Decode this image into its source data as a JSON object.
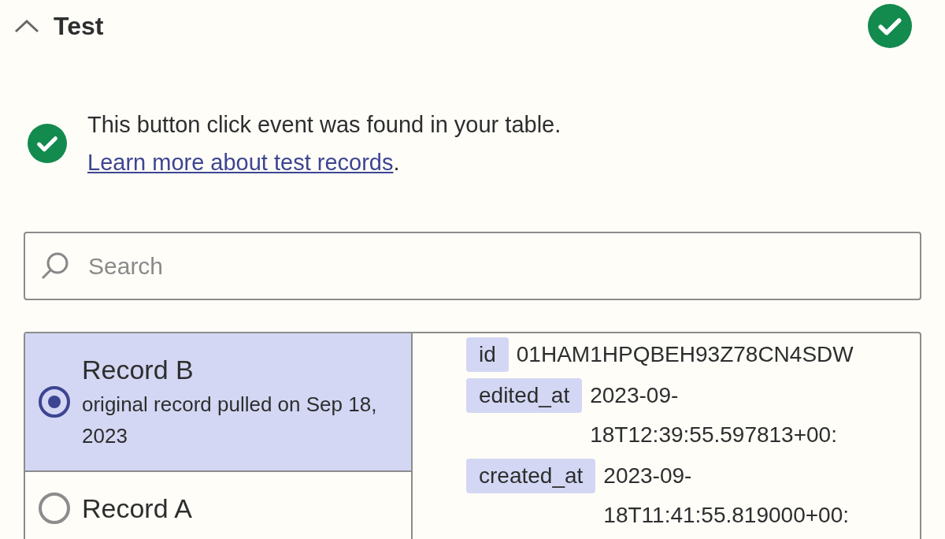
{
  "section": {
    "title": "Test",
    "expanded": true,
    "complete": true
  },
  "notice": {
    "text": "This button click event was found in your table.",
    "link": "Learn more about test records",
    "after": "."
  },
  "search": {
    "placeholder": "Search"
  },
  "records": [
    {
      "title": "Record B",
      "subtitle": "original record pulled on Sep 18, 2023",
      "selected": true
    },
    {
      "title": "Record A",
      "selected": false
    }
  ],
  "fields": [
    {
      "key": "id",
      "value": "01HAM1HPQBEH93Z78CN4SDW"
    },
    {
      "key": "edited_at",
      "value": "2023-09-18T12:39:55.597813+00:"
    },
    {
      "key": "created_at",
      "value": "2023-09-18T11:41:55.819000+00:"
    }
  ]
}
